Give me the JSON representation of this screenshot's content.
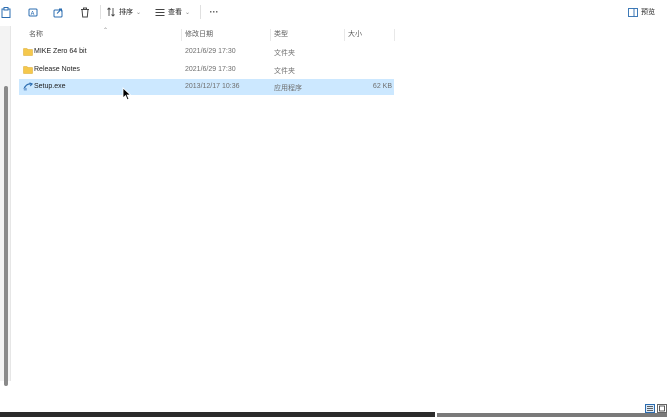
{
  "toolbar": {
    "sort_label": "排序",
    "view_label": "查看",
    "more_label": "···",
    "preview_label": "预览"
  },
  "columns": {
    "name": "名称",
    "modified": "修改日期",
    "type": "类型",
    "size": "大小"
  },
  "files": [
    {
      "name": "MIKE Zero 64 bit",
      "modified": "2021/6/29 17:30",
      "type": "文件夹",
      "size": "",
      "icon": "folder-icon"
    },
    {
      "name": "Release Notes",
      "modified": "2021/6/29 17:30",
      "type": "文件夹",
      "size": "",
      "icon": "folder-icon"
    },
    {
      "name": "Setup.exe",
      "modified": "2013/12/17 10:36",
      "type": "应用程序",
      "size": "62 KB",
      "icon": "setup-exe-icon",
      "selected": true
    }
  ],
  "colors": {
    "selection": "#cce8ff",
    "folder": "#f5c84c",
    "accent": "#2b6cb0"
  }
}
